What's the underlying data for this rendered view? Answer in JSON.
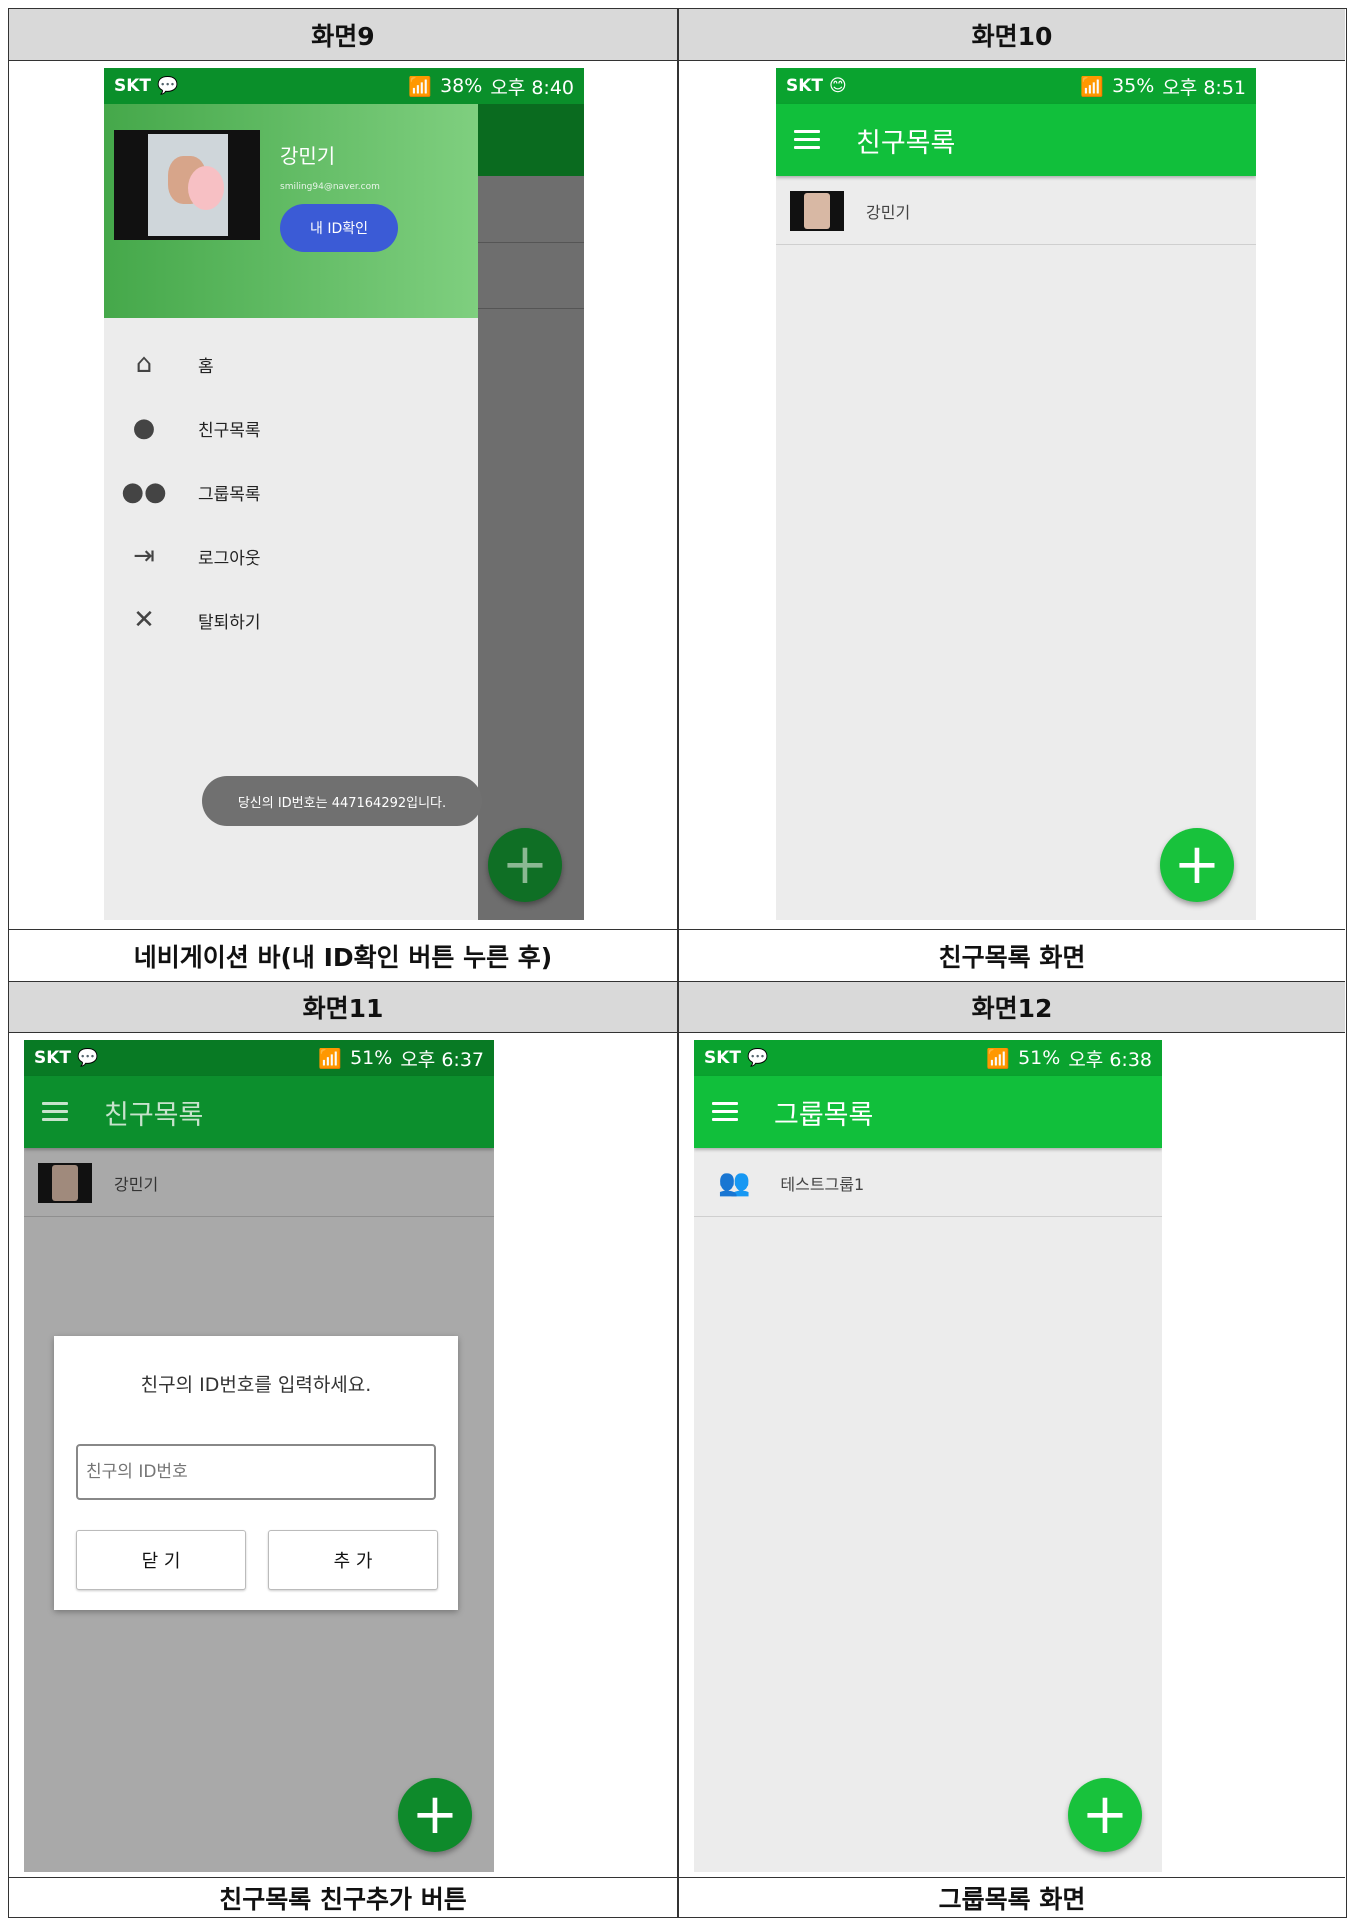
{
  "table": {
    "screen9": {
      "header": "화면9",
      "caption": "네비게이션 바(내 ID확인 버튼 누른 후)"
    },
    "screen10": {
      "header": "화면10",
      "caption": "친구목록 화면"
    },
    "screen11": {
      "header": "화면11",
      "caption": "친구목록 친구추가 버튼"
    },
    "screen12": {
      "header": "화면12",
      "caption": "그룹목록 화면"
    }
  },
  "colors": {
    "toolbar": "#11bf3b",
    "statusbar": "#0aa32f",
    "drawer_header": "#5cb85c",
    "fab": "#18c23c",
    "id_button": "#3b5bd6"
  },
  "phone9": {
    "carrier": "SKT",
    "battery": "38%",
    "time": "오후 8:40",
    "user_name": "강민기",
    "user_email": "smiling94@naver.com",
    "id_button": "내 ID확인",
    "menu": [
      {
        "icon": "home-icon",
        "label": "홈"
      },
      {
        "icon": "person-icon",
        "label": "친구목록"
      },
      {
        "icon": "group-icon",
        "label": "그룹목록"
      },
      {
        "icon": "logout-icon",
        "label": "로그아웃"
      },
      {
        "icon": "close-icon",
        "label": "탈퇴하기"
      }
    ],
    "toast": "당신의 ID번호는 447164292입니다.",
    "fab": "+"
  },
  "phone10": {
    "carrier": "SKT",
    "battery": "35%",
    "time": "오후 8:51",
    "title": "친구목록",
    "friend": "강민기",
    "fab": "+"
  },
  "phone11": {
    "carrier": "SKT",
    "battery": "51%",
    "time": "오후 6:37",
    "title": "친구목록",
    "friend": "강민기",
    "dialog_title": "친구의 ID번호를 입력하세요.",
    "input_placeholder": "친구의 ID번호",
    "close_button": "닫 기",
    "add_button": "추 가",
    "fab": "+"
  },
  "phone12": {
    "carrier": "SKT",
    "battery": "51%",
    "time": "오후 6:38",
    "title": "그룹목록",
    "group": "테스트그룹1",
    "fab": "+"
  }
}
